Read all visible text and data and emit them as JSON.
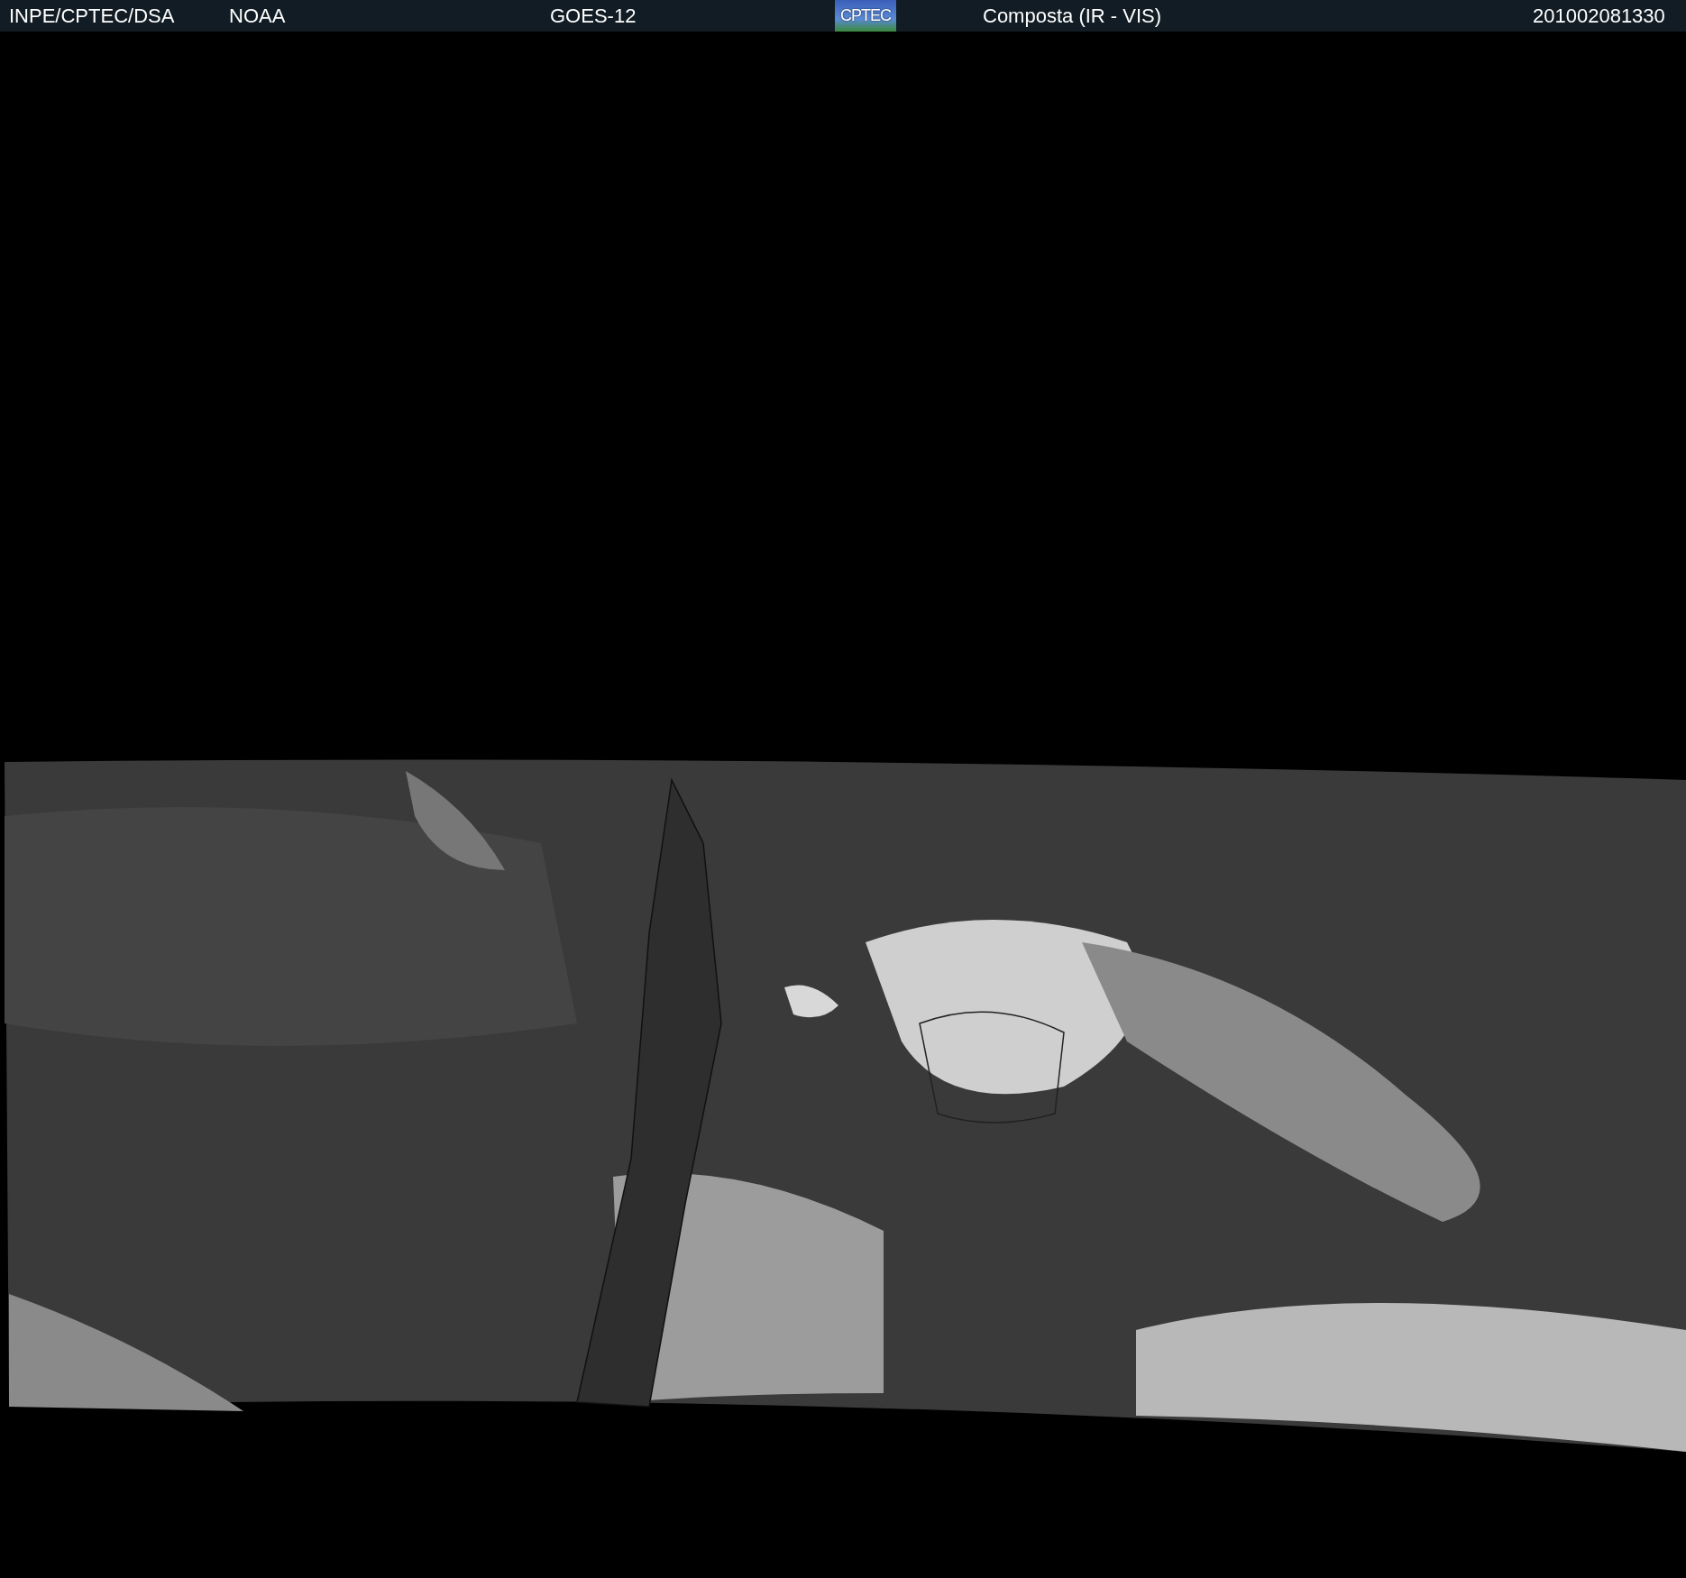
{
  "header": {
    "source": "INPE/CPTEC/DSA",
    "agency": "NOAA",
    "satellite": "GOES-12",
    "logo": "CPTEC",
    "product": "Composta (IR - VIS)",
    "timestamp": "201002081330"
  }
}
